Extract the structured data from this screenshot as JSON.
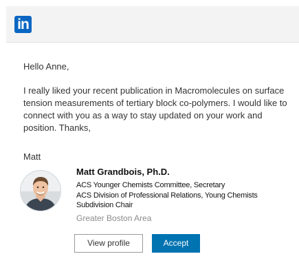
{
  "header": {
    "logo_text": "in",
    "logo_icon": "linkedin-logo-icon",
    "brand_color": "#0a66c2"
  },
  "email": {
    "greeting": "Hello Anne,",
    "body": "I really liked your recent publication in Macromolecules on surface tension measurements of tertiary block co-polymers. I would like to connect with you as a way to stay updated on your work and position. Thanks,",
    "signoff": "Matt"
  },
  "profile": {
    "name": "Matt Grandbois, Ph.D.",
    "roles": [
      "ACS Younger Chemists Committee, Secretary",
      "ACS Division of Professional Relations, Young Chemists Subdivision Chair"
    ],
    "location": "Greater Boston Area",
    "avatar_icon": "profile-photo"
  },
  "actions": {
    "view_profile_label": "View profile",
    "accept_label": "Accept",
    "accept_color": "#0073b1"
  }
}
